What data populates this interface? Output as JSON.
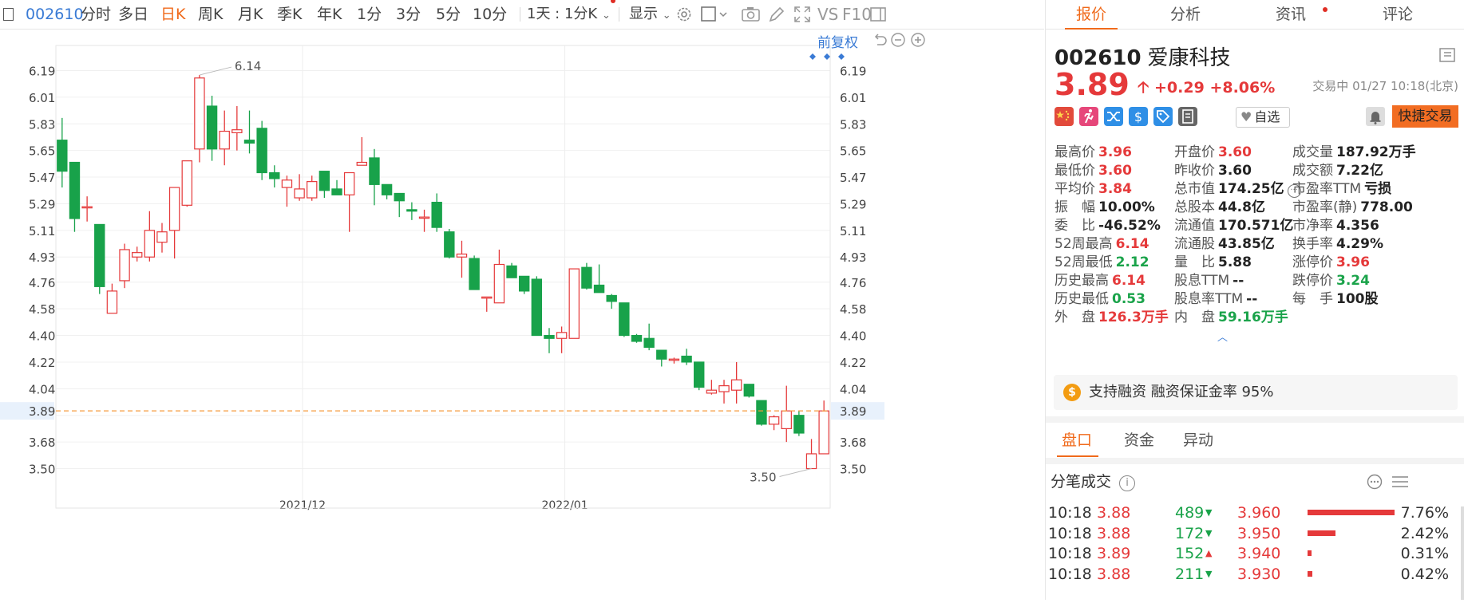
{
  "toolbar": {
    "code": "002610",
    "periods": [
      "分时",
      "多日",
      "日K",
      "周K",
      "月K",
      "季K",
      "年K",
      "1分",
      "3分",
      "5分",
      "10分"
    ],
    "active_period": "日K",
    "interval_select": "1天 : 1分K",
    "display_label": "显示",
    "vs_label": "VS",
    "f10_label": "F10"
  },
  "chart": {
    "fq_label": "前复权",
    "max_label": "6.14",
    "min_label": "3.50",
    "current_price_label": "3.89",
    "colors": {
      "up": "#e5393a",
      "down": "#18a24a",
      "cur": "#f59a3b"
    }
  },
  "chart_data": {
    "type": "candlestick",
    "x_labels": [
      "2021/12",
      "2022/01"
    ],
    "y_ticks": [
      "6.19",
      "6.01",
      "5.83",
      "5.65",
      "5.47",
      "5.29",
      "5.11",
      "4.93",
      "4.76",
      "4.58",
      "4.40",
      "4.22",
      "4.04",
      "3.86",
      "3.68",
      "3.50"
    ],
    "candles": [
      {
        "o": 5.72,
        "h": 5.87,
        "l": 5.4,
        "c": 5.51
      },
      {
        "o": 5.57,
        "h": 5.57,
        "l": 5.1,
        "c": 5.19
      },
      {
        "o": 5.27,
        "h": 5.34,
        "l": 5.17,
        "c": 5.27
      },
      {
        "o": 5.15,
        "h": 5.15,
        "l": 4.68,
        "c": 4.73
      },
      {
        "o": 4.55,
        "h": 4.75,
        "l": 4.55,
        "c": 4.7
      },
      {
        "o": 4.77,
        "h": 5.02,
        "l": 4.72,
        "c": 4.98
      },
      {
        "o": 4.93,
        "h": 5.0,
        "l": 4.9,
        "c": 4.96
      },
      {
        "o": 4.93,
        "h": 5.24,
        "l": 4.9,
        "c": 5.11
      },
      {
        "o": 5.03,
        "h": 5.16,
        "l": 4.96,
        "c": 5.1
      },
      {
        "o": 5.11,
        "h": 5.38,
        "l": 4.92,
        "c": 5.4
      },
      {
        "o": 5.28,
        "h": 5.57,
        "l": 5.27,
        "c": 5.58
      },
      {
        "o": 5.66,
        "h": 6.16,
        "l": 5.57,
        "c": 6.14
      },
      {
        "o": 5.95,
        "h": 6.02,
        "l": 5.58,
        "c": 5.66
      },
      {
        "o": 5.66,
        "h": 5.92,
        "l": 5.55,
        "c": 5.78
      },
      {
        "o": 5.77,
        "h": 5.95,
        "l": 5.65,
        "c": 5.79
      },
      {
        "o": 5.72,
        "h": 5.92,
        "l": 5.63,
        "c": 5.7
      },
      {
        "o": 5.8,
        "h": 5.85,
        "l": 5.45,
        "c": 5.5
      },
      {
        "o": 5.5,
        "h": 5.55,
        "l": 5.4,
        "c": 5.46
      },
      {
        "o": 5.4,
        "h": 5.48,
        "l": 5.27,
        "c": 5.45
      },
      {
        "o": 5.33,
        "h": 5.49,
        "l": 5.31,
        "c": 5.39
      },
      {
        "o": 5.33,
        "h": 5.48,
        "l": 5.31,
        "c": 5.44
      },
      {
        "o": 5.51,
        "h": 5.51,
        "l": 5.33,
        "c": 5.38
      },
      {
        "o": 5.39,
        "h": 5.45,
        "l": 5.35,
        "c": 5.35
      },
      {
        "o": 5.35,
        "h": 5.5,
        "l": 5.1,
        "c": 5.5
      },
      {
        "o": 5.55,
        "h": 5.74,
        "l": 5.55,
        "c": 5.57
      },
      {
        "o": 5.6,
        "h": 5.66,
        "l": 5.28,
        "c": 5.42
      },
      {
        "o": 5.42,
        "h": 5.42,
        "l": 5.32,
        "c": 5.35
      },
      {
        "o": 5.36,
        "h": 5.36,
        "l": 5.2,
        "c": 5.31
      },
      {
        "o": 5.25,
        "h": 5.3,
        "l": 5.18,
        "c": 5.24
      },
      {
        "o": 5.2,
        "h": 5.25,
        "l": 5.1,
        "c": 5.2
      },
      {
        "o": 5.3,
        "h": 5.36,
        "l": 5.1,
        "c": 5.13
      },
      {
        "o": 5.1,
        "h": 5.12,
        "l": 4.92,
        "c": 4.93
      },
      {
        "o": 4.93,
        "h": 5.04,
        "l": 4.79,
        "c": 4.95
      },
      {
        "o": 4.92,
        "h": 4.94,
        "l": 4.71,
        "c": 4.71
      },
      {
        "o": 4.66,
        "h": 4.66,
        "l": 4.56,
        "c": 4.66
      },
      {
        "o": 4.62,
        "h": 4.98,
        "l": 4.62,
        "c": 4.88
      },
      {
        "o": 4.87,
        "h": 4.89,
        "l": 4.81,
        "c": 4.79
      },
      {
        "o": 4.8,
        "h": 4.8,
        "l": 4.68,
        "c": 4.7
      },
      {
        "o": 4.78,
        "h": 4.8,
        "l": 4.4,
        "c": 4.4
      },
      {
        "o": 4.4,
        "h": 4.45,
        "l": 4.28,
        "c": 4.38
      },
      {
        "o": 4.38,
        "h": 4.46,
        "l": 4.28,
        "c": 4.42
      },
      {
        "o": 4.38,
        "h": 4.84,
        "l": 4.38,
        "c": 4.85
      },
      {
        "o": 4.86,
        "h": 4.89,
        "l": 4.71,
        "c": 4.72
      },
      {
        "o": 4.74,
        "h": 4.88,
        "l": 4.69,
        "c": 4.69
      },
      {
        "o": 4.67,
        "h": 4.68,
        "l": 4.58,
        "c": 4.63
      },
      {
        "o": 4.62,
        "h": 4.62,
        "l": 4.39,
        "c": 4.4
      },
      {
        "o": 4.4,
        "h": 4.41,
        "l": 4.35,
        "c": 4.36
      },
      {
        "o": 4.38,
        "h": 4.48,
        "l": 4.3,
        "c": 4.32
      },
      {
        "o": 4.3,
        "h": 4.3,
        "l": 4.19,
        "c": 4.24
      },
      {
        "o": 4.24,
        "h": 4.25,
        "l": 4.21,
        "c": 4.24
      },
      {
        "o": 4.26,
        "h": 4.31,
        "l": 4.2,
        "c": 4.22
      },
      {
        "o": 4.22,
        "h": 4.22,
        "l": 4.03,
        "c": 4.05
      },
      {
        "o": 4.01,
        "h": 4.1,
        "l": 4.0,
        "c": 4.03
      },
      {
        "o": 4.02,
        "h": 4.1,
        "l": 3.94,
        "c": 4.06
      },
      {
        "o": 4.03,
        "h": 4.22,
        "l": 3.94,
        "c": 4.1
      },
      {
        "o": 4.07,
        "h": 4.07,
        "l": 3.98,
        "c": 3.99
      },
      {
        "o": 3.96,
        "h": 3.96,
        "l": 3.79,
        "c": 3.8
      },
      {
        "o": 3.8,
        "h": 3.86,
        "l": 3.76,
        "c": 3.85
      },
      {
        "o": 3.77,
        "h": 4.06,
        "l": 3.68,
        "c": 3.89
      },
      {
        "o": 3.86,
        "h": 3.89,
        "l": 3.72,
        "c": 3.74
      },
      {
        "o": 3.5,
        "h": 3.7,
        "l": 3.5,
        "c": 3.6
      },
      {
        "o": 3.6,
        "h": 3.96,
        "l": 3.6,
        "c": 3.89
      }
    ],
    "x_label_index": [
      19,
      40
    ],
    "ylim": [
      3.5,
      6.19
    ],
    "current": 3.89,
    "max": 6.14,
    "min": 3.5
  },
  "tabs": [
    "报价",
    "分析",
    "资讯",
    "评论"
  ],
  "stock": {
    "code": "002610",
    "name": "爱康科技",
    "price": "3.89",
    "change": "+0.29",
    "pct": "+8.06%",
    "state": "交易中 01/27 10:18(北京)",
    "zixuan_label": "自选",
    "quick_trade_label": "快捷交易"
  },
  "quote": [
    [
      [
        "最高价",
        "3.96",
        "red"
      ],
      [
        "开盘价",
        "3.60",
        "red"
      ],
      [
        "成交量",
        "187.92万手",
        "dark"
      ]
    ],
    [
      [
        "最低价",
        "3.60",
        "red"
      ],
      [
        "昨收价",
        "3.60",
        "dark"
      ],
      [
        "成交额",
        "7.22亿",
        "dark"
      ]
    ],
    [
      [
        "平均价",
        "3.84",
        "red"
      ],
      [
        "总市值",
        "174.25亿",
        "dark"
      ],
      [
        "市盈率TTM",
        "亏损",
        "dark"
      ]
    ],
    [
      [
        "振　幅",
        "10.00%",
        "dark"
      ],
      [
        "总股本",
        "44.8亿",
        "dark"
      ],
      [
        "市盈率(静)",
        "778.00",
        "dark"
      ]
    ],
    [
      [
        "委　比",
        "-46.52%",
        "dark"
      ],
      [
        "流通值",
        "170.571亿",
        "dark"
      ],
      [
        "市净率",
        "4.356",
        "dark"
      ]
    ],
    [
      [
        "52周最高",
        "6.14",
        "red"
      ],
      [
        "流通股",
        "43.85亿",
        "dark"
      ],
      [
        "换手率",
        "4.29%",
        "dark"
      ]
    ],
    [
      [
        "52周最低",
        "2.12",
        "green"
      ],
      [
        "量　比",
        "5.88",
        "dark"
      ],
      [
        "涨停价",
        "3.96",
        "red"
      ]
    ],
    [
      [
        "历史最高",
        "6.14",
        "red"
      ],
      [
        "股息TTM",
        "--",
        "dark"
      ],
      [
        "跌停价",
        "3.24",
        "green"
      ]
    ],
    [
      [
        "历史最低",
        "0.53",
        "green"
      ],
      [
        "股息率TTM",
        "--",
        "dark"
      ],
      [
        "每　手",
        "100股",
        "dark"
      ]
    ],
    [
      [
        "外　盘",
        "126.3万手",
        "red"
      ],
      [
        "内　盘",
        "59.16万手",
        "green"
      ],
      null
    ]
  ],
  "margin_text": "支持融资 融资保证金率 95%",
  "subtabs": [
    "盘口",
    "资金",
    "异动"
  ],
  "fenbi": {
    "title": "分笔成交",
    "rows": [
      {
        "time": "10:18",
        "price": "3.88",
        "vol": "489",
        "dir": "down",
        "bp": "3.960",
        "bar": 0.95,
        "pct": "7.76%"
      },
      {
        "time": "10:18",
        "price": "3.88",
        "vol": "172",
        "dir": "down",
        "bp": "3.950",
        "bar": 0.3,
        "pct": "2.42%"
      },
      {
        "time": "10:18",
        "price": "3.89",
        "vol": "152",
        "dir": "up",
        "bp": "3.940",
        "bar": 0.04,
        "pct": "0.31%"
      },
      {
        "time": "10:18",
        "price": "3.88",
        "vol": "211",
        "dir": "down",
        "bp": "3.930",
        "bar": 0.05,
        "pct": "0.42%"
      }
    ]
  }
}
